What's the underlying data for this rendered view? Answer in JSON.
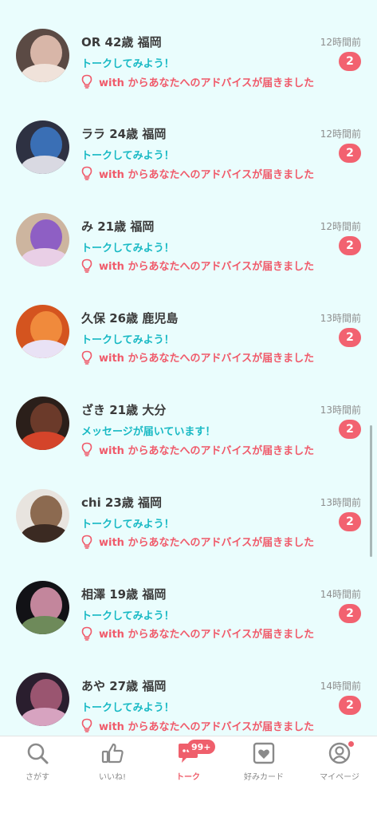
{
  "conversations": [
    {
      "name": "OR 42歳 福岡",
      "time": "12時間前",
      "message": "トークしてみよう！",
      "advice": "with からあなたへのアドバイスが届きました",
      "unread": "2",
      "avatar_colors": [
        "#5b4a44",
        "#d8b6a8",
        "#f0e2da"
      ]
    },
    {
      "name": "ララ 24歳 福岡",
      "time": "12時間前",
      "message": "トークしてみよう！",
      "advice": "with からあなたへのアドバイスが届きました",
      "unread": "2",
      "avatar_colors": [
        "#2e3142",
        "#3a6fb5",
        "#d9d9e2"
      ]
    },
    {
      "name": "み 21歳 福岡",
      "time": "12時間前",
      "message": "トークしてみよう！",
      "advice": "with からあなたへのアドバイスが届きました",
      "unread": "2",
      "avatar_colors": [
        "#cdb59f",
        "#8e5fc4",
        "#e9cfe6"
      ]
    },
    {
      "name": "久保 26歳 鹿児島",
      "time": "13時間前",
      "message": "トークしてみよう！",
      "advice": "with からあなたへのアドバイスが届きました",
      "unread": "2",
      "avatar_colors": [
        "#d4541f",
        "#f08a3c",
        "#e9e2f5"
      ]
    },
    {
      "name": "ざき 21歳 大分",
      "time": "13時間前",
      "message": "メッセージが届いています！",
      "advice": "with からあなたへのアドバイスが届きました",
      "unread": "2",
      "avatar_colors": [
        "#2b1f1a",
        "#6b3a2a",
        "#d4442a"
      ]
    },
    {
      "name": "chi 23歳 福岡",
      "time": "13時間前",
      "message": "トークしてみよう！",
      "advice": "with からあなたへのアドバイスが届きました",
      "unread": "2",
      "avatar_colors": [
        "#e8e4df",
        "#8c6a50",
        "#3b2a22"
      ]
    },
    {
      "name": "相澤 19歳 福岡",
      "time": "14時間前",
      "message": "トークしてみよう！",
      "advice": "with からあなたへのアドバイスが届きました",
      "unread": "2",
      "avatar_colors": [
        "#121216",
        "#c3869c",
        "#6e8a5a"
      ]
    },
    {
      "name": "あや 27歳 福岡",
      "time": "14時間前",
      "message": "トークしてみよう！",
      "advice": "with からあなたへのアドバイスが届きました",
      "unread": "2",
      "avatar_colors": [
        "#2a1e2e",
        "#9a5570",
        "#d7a3c0"
      ]
    }
  ],
  "tabbar": {
    "tabs": [
      {
        "label": "さがす",
        "icon": "search-icon"
      },
      {
        "label": "いいね!",
        "icon": "thumbs-up-icon"
      },
      {
        "label": "トーク",
        "icon": "chat-icon",
        "badge": "99+",
        "active": true
      },
      {
        "label": "好みカード",
        "icon": "heart-card-icon"
      },
      {
        "label": "マイページ",
        "icon": "profile-icon",
        "notification_dot": true
      }
    ]
  },
  "colors": {
    "list_background": "#eafdfd",
    "accent_pink": "#ef5f6c",
    "message_teal": "#18b9c4",
    "tab_inactive": "#8a8a8a"
  }
}
